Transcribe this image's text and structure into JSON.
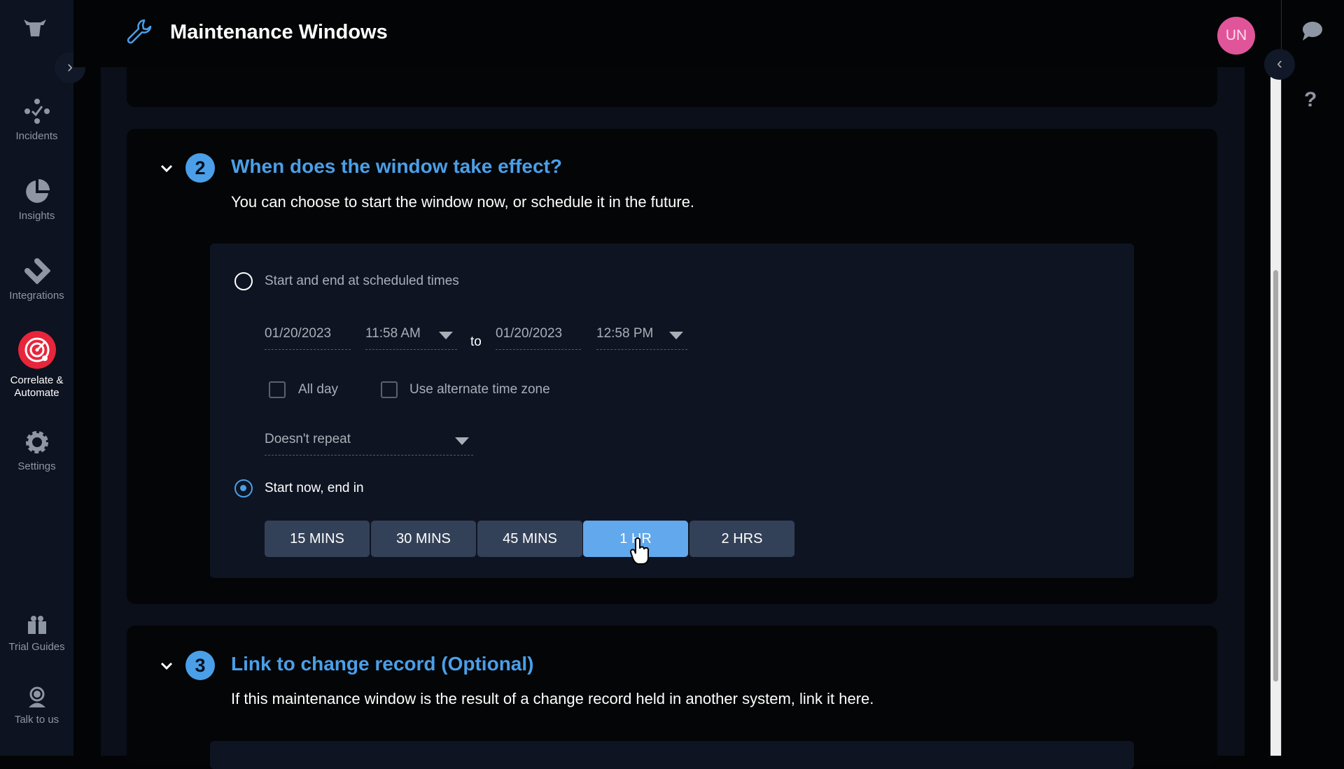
{
  "header": {
    "title": "Maintenance Windows",
    "avatar_initials": "UN"
  },
  "sidebar": {
    "items": [
      {
        "label": "Incidents",
        "icon": "incidents-icon"
      },
      {
        "label": "Insights",
        "icon": "pie-chart-icon"
      },
      {
        "label": "Integrations",
        "icon": "integrations-icon"
      },
      {
        "label": "Correlate & Automate",
        "icon": "radar-icon",
        "active": true
      },
      {
        "label": "Settings",
        "icon": "gear-icon"
      },
      {
        "label": "Trial Guides",
        "icon": "gift-icon"
      },
      {
        "label": "Talk to us",
        "icon": "support-agent-icon"
      }
    ]
  },
  "section2": {
    "number": "2",
    "title": "When does the window take effect?",
    "subtitle": "You can choose to start the window now, or schedule it in the future.",
    "option_scheduled": "Start and end at scheduled times",
    "start_date": "01/20/2023",
    "start_time": "11:58 AM",
    "to": "to",
    "end_date": "01/20/2023",
    "end_time": "12:58 PM",
    "all_day": "All day",
    "alt_tz": "Use alternate time zone",
    "repeat": "Doesn't repeat",
    "option_now": "Start now, end in",
    "selected_option": "now",
    "durations": [
      "15 MINS",
      "30 MINS",
      "45 MINS",
      "1 HR",
      "2 HRS"
    ],
    "selected_duration": "1 HR"
  },
  "section3": {
    "number": "3",
    "title": "Link to change record (Optional)",
    "subtitle": "If this maintenance window is the result of a change record held in another system, link it here."
  },
  "colors": {
    "accent": "#4a9fe8",
    "active_button": "#62a8ec",
    "avatar": "#e0559a",
    "nav_active": "#e8253a"
  }
}
